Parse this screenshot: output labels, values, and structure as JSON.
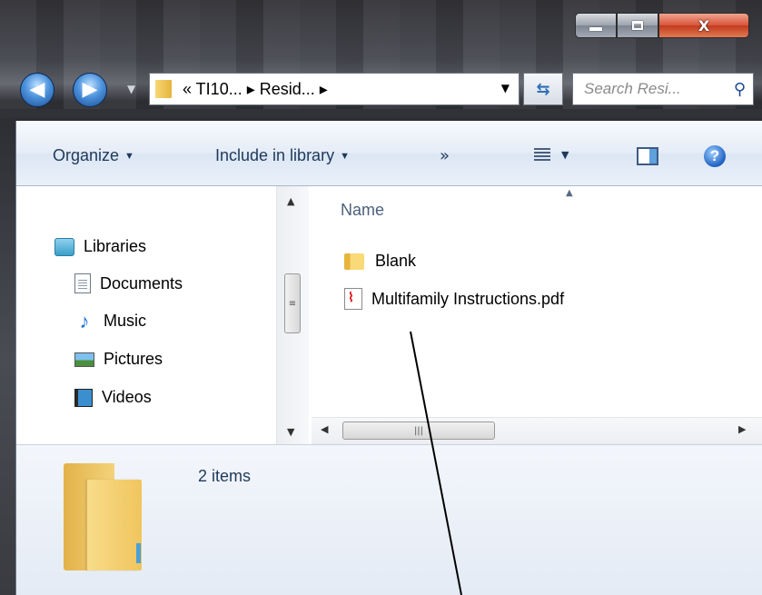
{
  "window": {
    "address_path": "«  TI10...  ▸  Resid...  ▸",
    "search_placeholder": "Search Resi..."
  },
  "caption_buttons": {
    "minimize_icon": "minimize-icon",
    "maximize_icon": "maximize-icon",
    "close_label": "X"
  },
  "nav_buttons": {
    "back_icon": "back-arrow-icon",
    "forward_icon": "forward-arrow-icon",
    "refresh_icon": "refresh-icon",
    "search_icon": "search-icon"
  },
  "toolbar": {
    "organize": "Organize",
    "include_in_library": "Include in library",
    "more": "»",
    "help": "?"
  },
  "nav_pane": {
    "libraries": "Libraries",
    "items": [
      "Documents",
      "Music",
      "Pictures",
      "Videos"
    ]
  },
  "content": {
    "column_header": "Name",
    "files": [
      {
        "name": "Blank",
        "type": "folder"
      },
      {
        "name": "Multifamily Instructions.pdf",
        "type": "pdf"
      }
    ]
  },
  "details": {
    "item_count": "2 items"
  },
  "colors": {
    "title_text": "#1e395b",
    "close_red": "#c23a1e",
    "folder_yellow": "#f4d27a"
  }
}
